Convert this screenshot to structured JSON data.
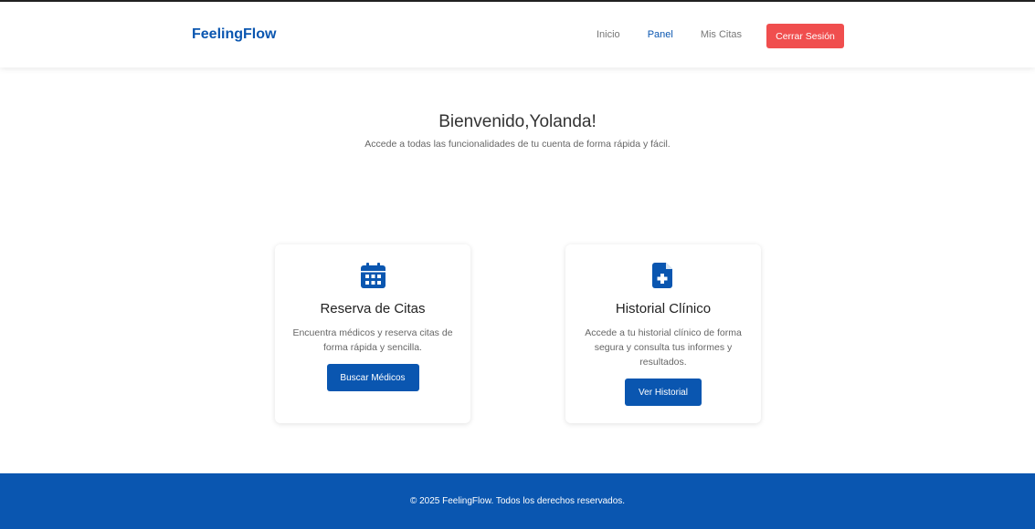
{
  "nav": {
    "brand": "FeelingFlow",
    "links": [
      {
        "label": "Inicio"
      },
      {
        "label": "Panel"
      },
      {
        "label": "Mis Citas"
      }
    ],
    "logout_label": "Cerrar Sesión"
  },
  "welcome": {
    "title": "Bienvenido,Yolanda!",
    "subtitle": "Accede a todas las funcionalidades de tu cuenta de forma rápida y fácil."
  },
  "cards": [
    {
      "icon": "calendar-icon",
      "title": "Reserva de Citas",
      "description": "Encuentra médicos y reserva citas de forma rápida y sencilla.",
      "button_label": "Buscar Médicos"
    },
    {
      "icon": "medical-file-icon",
      "title": "Historial Clínico",
      "description": "Accede a tu historial clínico de forma segura y consulta tus informes y resultados.",
      "button_label": "Ver Historial"
    }
  ],
  "footer": {
    "text": "© 2025 FeelingFlow. Todos los derechos reservados."
  },
  "colors": {
    "primary": "#0a56b0",
    "logout": "#f04e4e",
    "footer_bg": "#0a56b0"
  }
}
